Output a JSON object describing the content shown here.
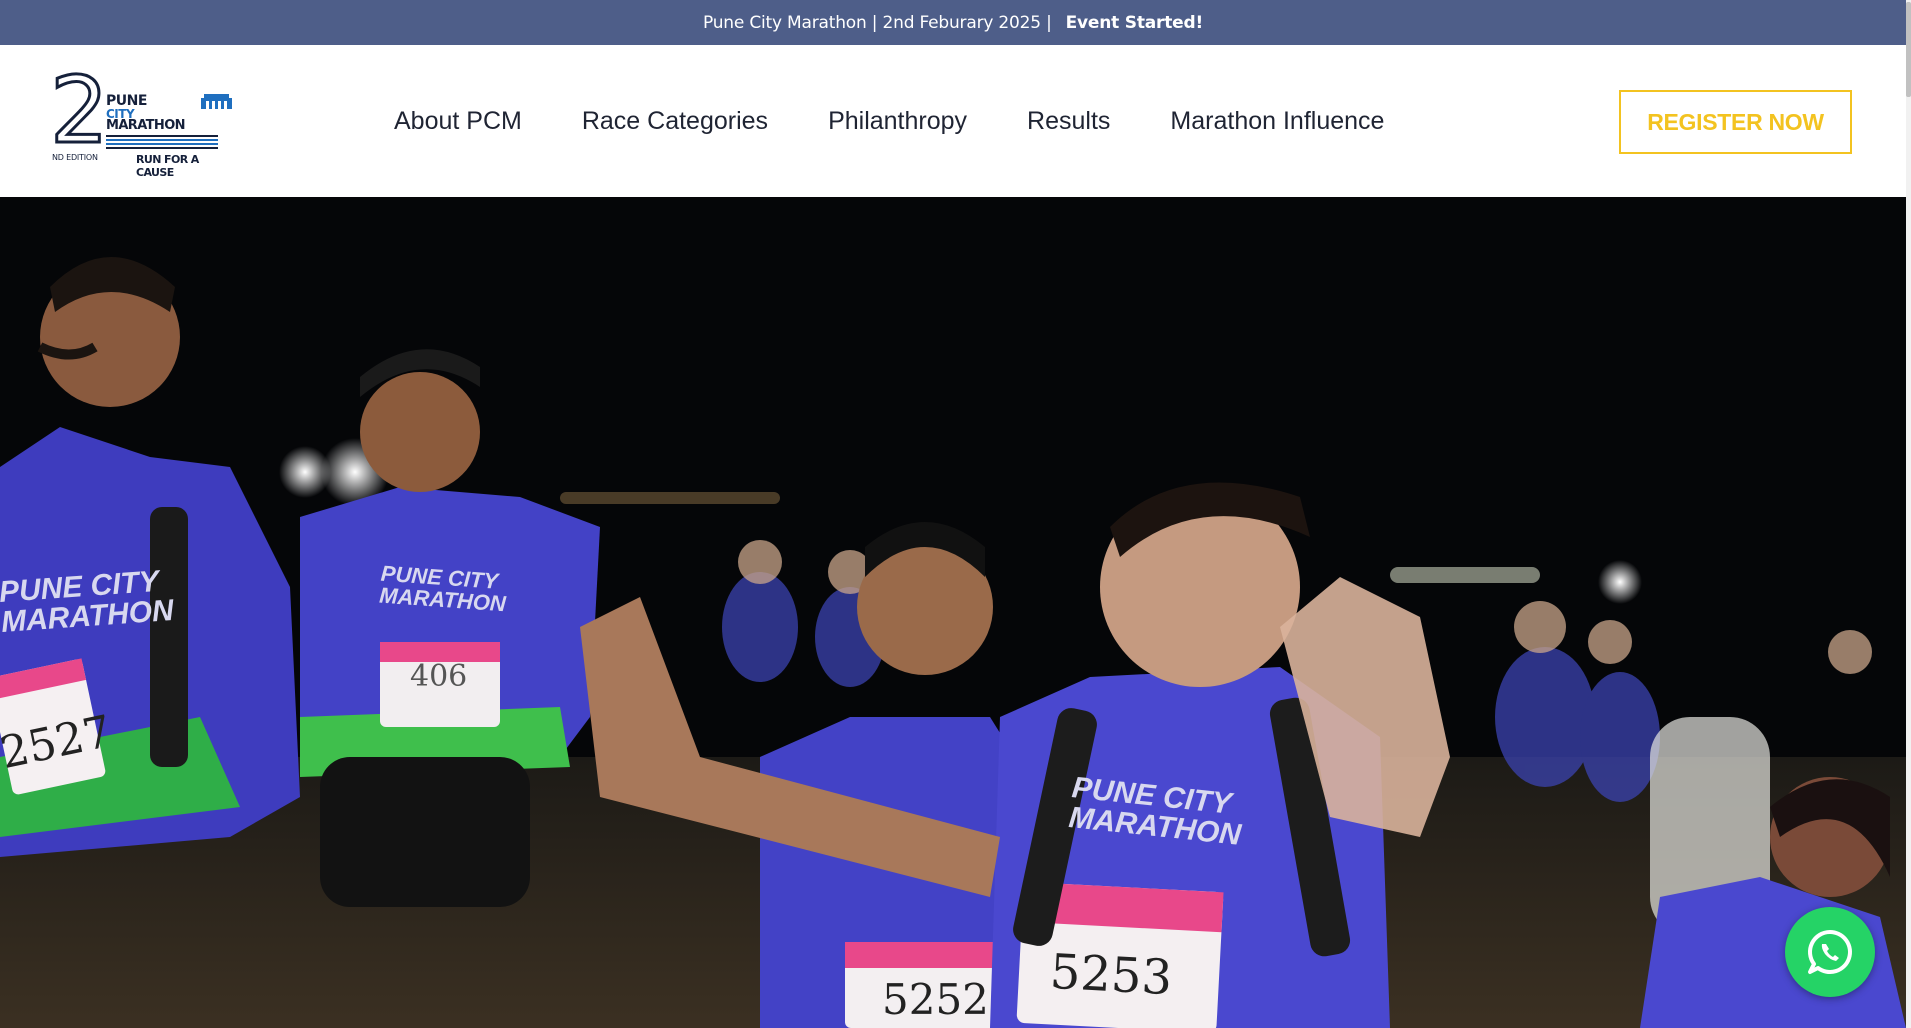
{
  "announcement": {
    "text": "Pune City Marathon | 2nd Feburary 2025 |",
    "status": "Event Started!"
  },
  "logo": {
    "number": "2",
    "edition": "ND EDITION",
    "line1": "PUNE",
    "line2": "CITY",
    "line3": "MARATHON",
    "tagline": "RUN FOR A CAUSE"
  },
  "nav": {
    "items": [
      {
        "label": "About PCM"
      },
      {
        "label": "Race Categories"
      },
      {
        "label": "Philanthropy"
      },
      {
        "label": "Results"
      },
      {
        "label": "Marathon Influence"
      }
    ]
  },
  "register": {
    "label": "REGISTER NOW"
  },
  "hero": {
    "shirt_text_1": "PUNE CITY",
    "shirt_text_2": "MARATHON",
    "bibs": [
      "2527",
      "406",
      "5252",
      "5253"
    ]
  },
  "colors": {
    "topbar": "#4e5e89",
    "accent": "#f3c320",
    "brand_dark": "#15203a",
    "brand_blue": "#1f6fbf",
    "whatsapp": "#25d366"
  },
  "icons": {
    "whatsapp": "whatsapp-icon"
  }
}
